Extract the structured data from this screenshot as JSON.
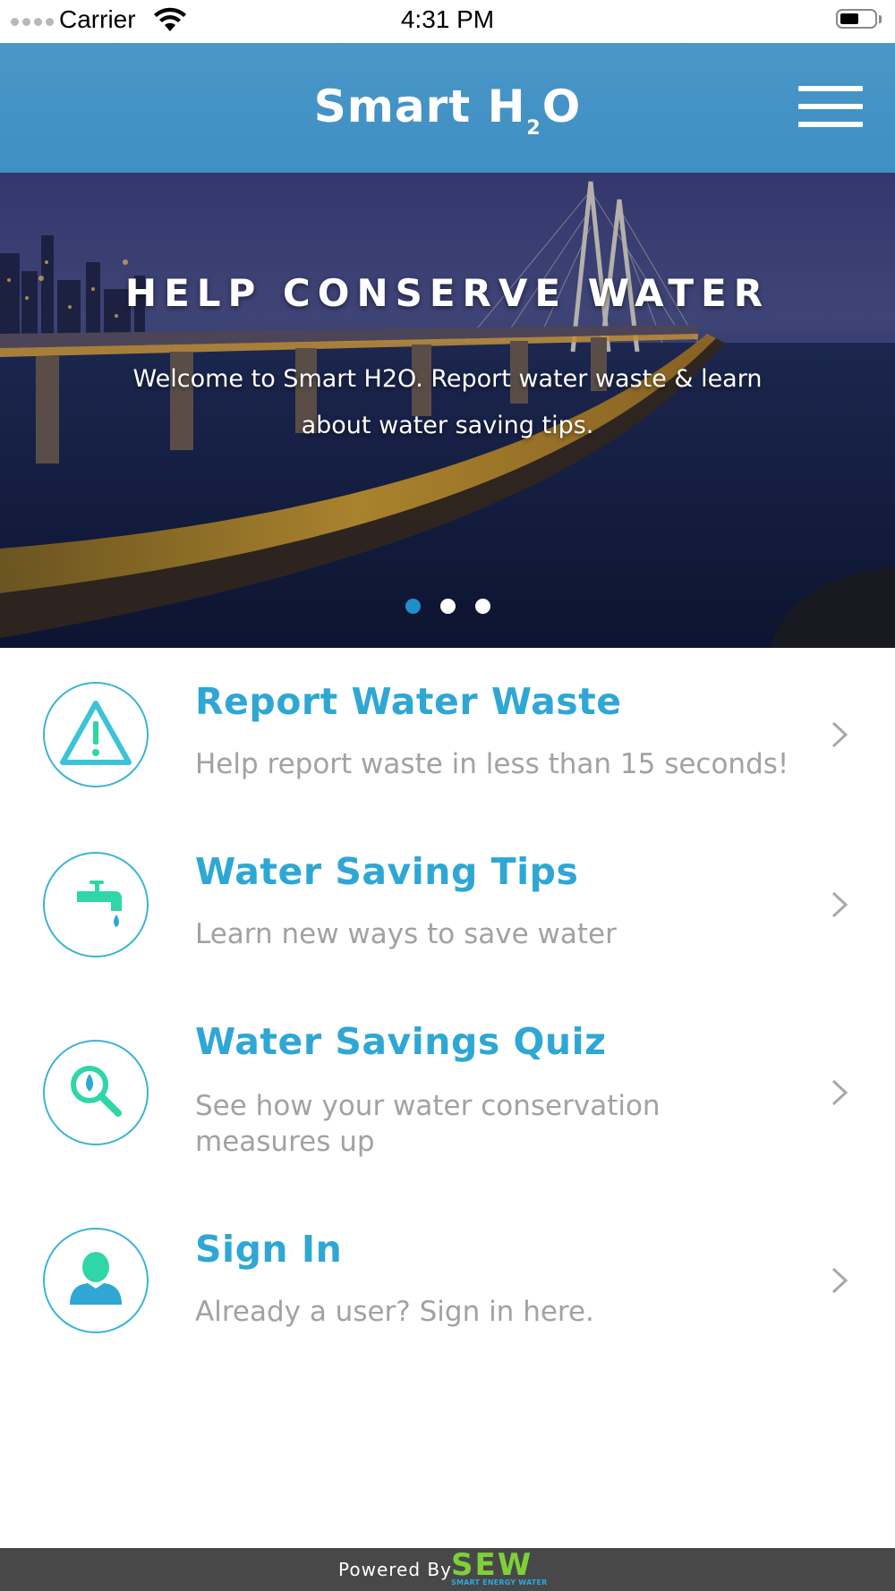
{
  "status_bar": {
    "carrier": "Carrier",
    "time": "4:31 PM"
  },
  "header": {
    "title_main": "Smart H",
    "title_sub": "2",
    "title_end": "O",
    "menu_icon": "hamburger-menu-icon"
  },
  "hero": {
    "title": "HELP CONSERVE WATER",
    "subtitle": "Welcome to Smart H2O. Report water waste & learn about water saving tips.",
    "active_slide": 1,
    "slide_count": 3
  },
  "menu": [
    {
      "title": "Report Water Waste",
      "description": "Help report waste in less than 15 seconds!",
      "icon": "warning-triangle-icon"
    },
    {
      "title": "Water Saving Tips",
      "description": "Learn new ways to save water",
      "icon": "water-faucet-icon"
    },
    {
      "title": "Water Savings Quiz",
      "description": "See how your water conservation measures up",
      "icon": "magnifier-droplet-icon"
    },
    {
      "title": "Sign In",
      "description": "Already a user? Sign in here.",
      "icon": "user-icon"
    }
  ],
  "footer": {
    "label": "Powered By",
    "logo_text": "SEW",
    "logo_tagline": "SMART ENERGY WATER"
  },
  "colors": {
    "header_blue": "#4394c6",
    "title_blue": "#2fa7d4",
    "icon_teal": "#2fd6a7",
    "description_gray": "#a2a2a2",
    "footer_gray": "#484848",
    "active_dot": "#1e8fc9"
  }
}
